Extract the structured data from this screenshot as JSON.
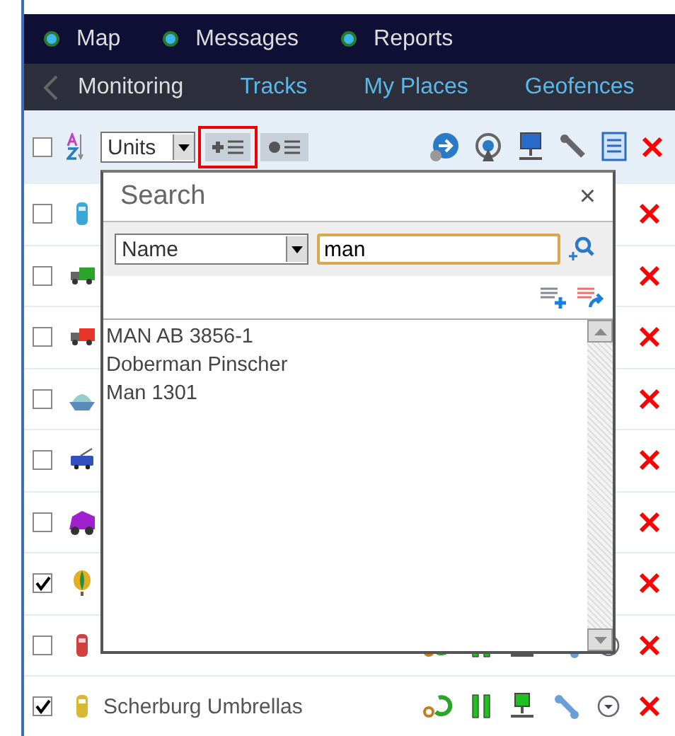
{
  "nav": [
    {
      "label": "Map"
    },
    {
      "label": "Messages"
    },
    {
      "label": "Reports"
    }
  ],
  "tabs": [
    {
      "label": "Monitoring",
      "selected": true
    },
    {
      "label": "Tracks",
      "selected": false
    },
    {
      "label": "My Places",
      "selected": false
    },
    {
      "label": "Geofences",
      "selected": false
    }
  ],
  "toolbar": {
    "checked": false,
    "list_type": "Units",
    "add_to_list_highlighted": true
  },
  "units": [
    {
      "checked": false,
      "kind": "covered"
    },
    {
      "checked": false,
      "kind": "covered"
    },
    {
      "checked": false,
      "kind": "covered"
    },
    {
      "checked": false,
      "kind": "covered"
    },
    {
      "checked": false,
      "kind": "covered"
    },
    {
      "checked": false,
      "kind": "covered"
    },
    {
      "checked": true,
      "kind": "covered"
    },
    {
      "checked": false,
      "kind": "full"
    },
    {
      "name": "Scherburg Umbrellas",
      "checked": true,
      "kind": "full"
    }
  ],
  "search_dialog": {
    "title": "Search",
    "close": "×",
    "field": "Name",
    "query": "man",
    "results": [
      {
        "name": "MAN AB 3856-1"
      },
      {
        "name": "Doberman Pinscher"
      },
      {
        "name": "Man 1301"
      }
    ]
  }
}
